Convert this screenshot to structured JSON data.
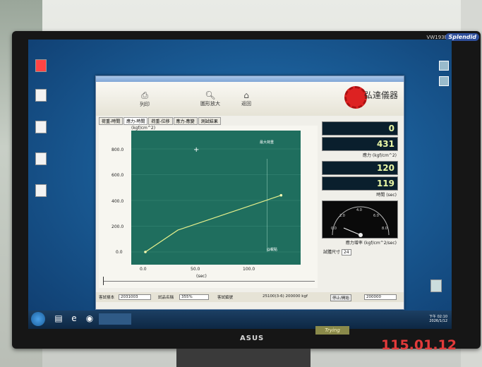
{
  "monitor": {
    "model": "VW193D",
    "brand": "Splendid",
    "logo": "ASUS",
    "sticker": "Trying"
  },
  "photo_date_stamp": "115.01.12",
  "toolbar": {
    "print": "列印",
    "zoom": "圖形放大",
    "back": "返回",
    "brand": "弘達儀器"
  },
  "tabs": [
    "荷重-時間",
    "應力-時間",
    "荷重-位移",
    "應力-應變",
    "測試結果"
  ],
  "chart_data": {
    "type": "line",
    "ylabel": "(kgf/cm^2)",
    "xlabel": "(sec)",
    "y_ticks": [
      "800.0",
      "600.0",
      "400.0",
      "200.0",
      "0.0"
    ],
    "x_ticks": [
      "0.0",
      "50.0",
      "100.0"
    ],
    "series": [
      {
        "x": [
          0,
          30,
          125
        ],
        "y": [
          0,
          170,
          440
        ]
      }
    ],
    "annotations": [
      "最大荷重",
      "@載點"
    ]
  },
  "readouts": {
    "load_top": "0",
    "stress": "431",
    "stress_label": "應力 (kgf/cm^2)",
    "time1": "120",
    "time2": "119",
    "time_label": "時間   (sec)",
    "rate_label": "應力增率   (kgf/cm^2/sec)",
    "small_label": "試體尺寸",
    "small_value": "24"
  },
  "gauge": {
    "ticks": [
      "0.0",
      "2.0",
      "4.0",
      "6.0",
      "8.0"
    ]
  },
  "status": {
    "f1_label": "客試樣本",
    "f1_value": "2031003",
    "f2_label": "試品名稱",
    "f2_value": "355%",
    "f3_label": "客試編號",
    "f3_value": "",
    "range": "25100(3-6) 200000 kgf",
    "btn": "停止/開始",
    "last": "200000"
  },
  "taskbar": {
    "clock": "下午 02:10\n2026/1/12"
  }
}
